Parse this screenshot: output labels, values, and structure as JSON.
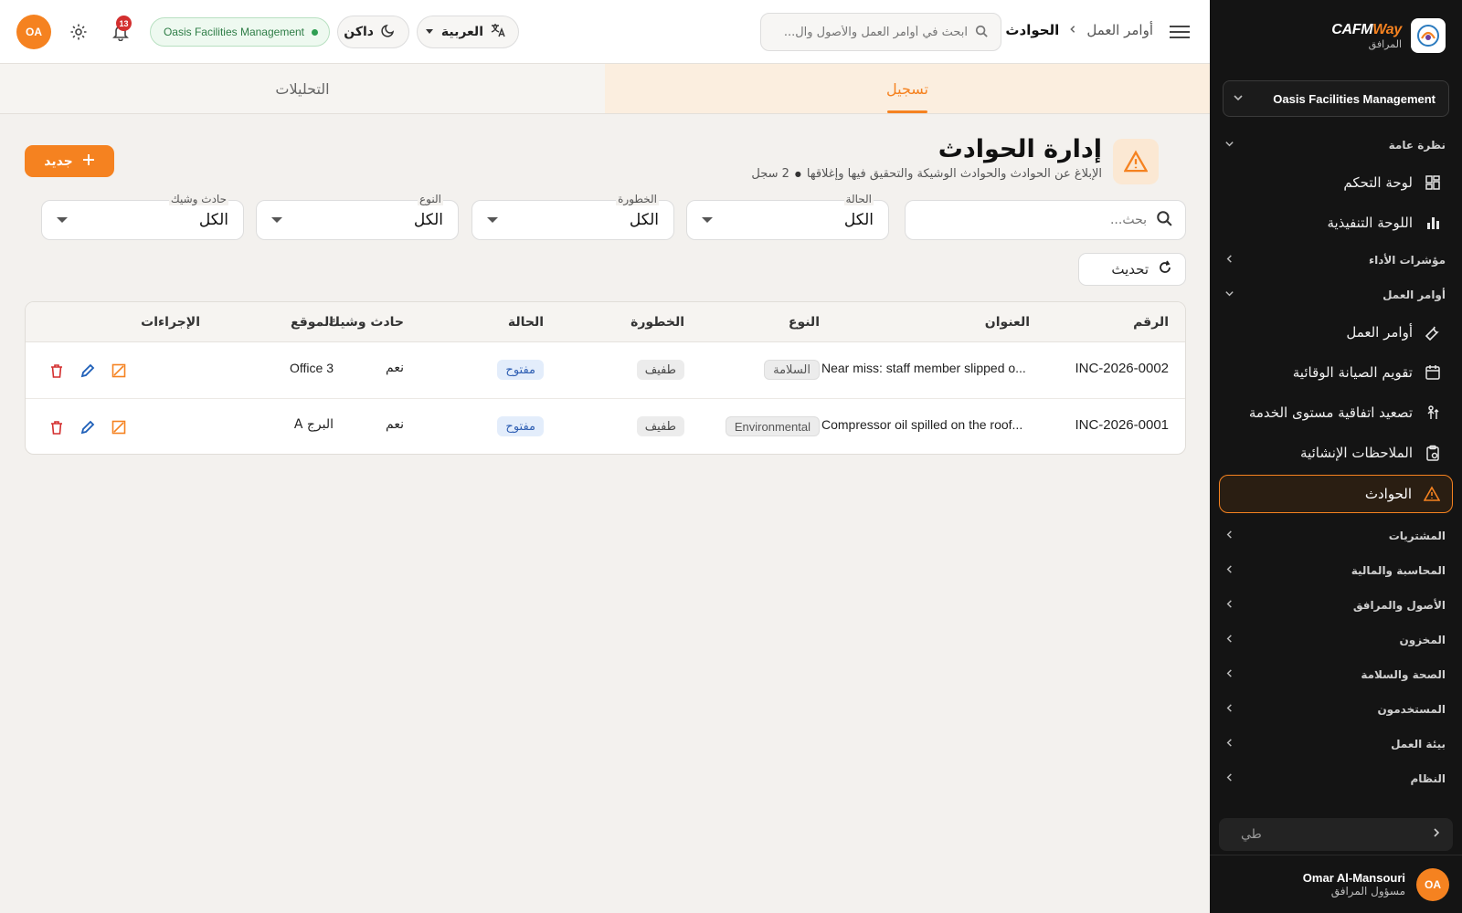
{
  "brand": {
    "name_a": "CAFM",
    "name_b": "Way",
    "subtitle": "المرافق"
  },
  "sidebar": {
    "org_selector": "Oasis Facilities Management",
    "sections": [
      {
        "label": "نظرة عامة",
        "expanded": true,
        "items": [
          {
            "label": "لوحة التحكم",
            "icon": "dashboard-icon"
          },
          {
            "label": "اللوحة التنفيذية",
            "icon": "bar-chart-icon"
          }
        ]
      },
      {
        "label": "مؤشرات الأداء",
        "expanded": false,
        "items": []
      },
      {
        "label": "أوامر العمل",
        "expanded": true,
        "items": [
          {
            "label": "أوامر العمل",
            "icon": "wrench-icon"
          },
          {
            "label": "تقويم الصيانة الوقائية",
            "icon": "calendar-icon"
          },
          {
            "label": "تصعيد اتفاقية مستوى الخدمة",
            "icon": "escalation-icon"
          },
          {
            "label": "الملاحظات الإنشائية",
            "icon": "clipboard-icon"
          },
          {
            "label": "الحوادث",
            "icon": "warning-icon",
            "active": true
          }
        ]
      },
      {
        "label": "المشتريات",
        "expanded": false,
        "items": []
      },
      {
        "label": "المحاسبة والمالية",
        "expanded": false,
        "items": []
      },
      {
        "label": "الأصول والمرافق",
        "expanded": false,
        "items": []
      },
      {
        "label": "المخزون",
        "expanded": false,
        "items": []
      },
      {
        "label": "الصحة والسلامة",
        "expanded": false,
        "items": []
      },
      {
        "label": "المستخدمون",
        "expanded": false,
        "items": []
      },
      {
        "label": "بيئة العمل",
        "expanded": false,
        "items": []
      },
      {
        "label": "النظام",
        "expanded": false,
        "items": []
      }
    ],
    "collapse_label": "طي",
    "user": {
      "initials": "OA",
      "name": "Omar Al-Mansouri",
      "role": "مسؤول المرافق"
    }
  },
  "topbar": {
    "breadcrumb": [
      "أوامر العمل",
      "الحوادث"
    ],
    "search_placeholder": "ابحث في أوامر العمل والأصول وال...",
    "language": "العربية",
    "theme": "داكن",
    "org_badge": "Oasis Facilities Management",
    "notifications_count": "13",
    "avatar_initials": "OA"
  },
  "tabs": [
    {
      "label": "تسجيل",
      "active": true
    },
    {
      "label": "التحليلات",
      "active": false
    }
  ],
  "page": {
    "title": "إدارة الحوادث",
    "subtitle": "الإبلاغ عن الحوادث والحوادث الوشيكة والتحقيق فيها وإغلاقها",
    "count": "2 سجل",
    "new_button": "جديد"
  },
  "filters": {
    "search_placeholder": "بحث...",
    "status": {
      "label": "الحالة",
      "value": "الكل"
    },
    "severity": {
      "label": "الخطورة",
      "value": "الكل"
    },
    "type": {
      "label": "النوع",
      "value": "الكل"
    },
    "near_miss": {
      "label": "حادث وشيك",
      "value": "الكل"
    },
    "refresh": "تحديث"
  },
  "table": {
    "headers": {
      "number": "الرقم",
      "title": "العنوان",
      "type": "النوع",
      "severity": "الخطورة",
      "status": "الحالة",
      "near_miss": "حادث وشيك",
      "location": "الموقع",
      "actions": "الإجراءات"
    },
    "rows": [
      {
        "number": "INC-2026-0002",
        "title": "Near miss: staff member slipped o...",
        "type": "السلامة",
        "severity": "طفيف",
        "status": "مفتوح",
        "near_miss": "نعم",
        "location": "Office 3"
      },
      {
        "number": "INC-2026-0001",
        "title": "Compressor oil spilled on the roof...",
        "type": "Environmental",
        "severity": "طفيف",
        "status": "مفتوح",
        "near_miss": "نعم",
        "location": "البرج A"
      }
    ]
  },
  "colors": {
    "accent": "#f58220",
    "sidebar_bg": "#141414",
    "status_blue": "#2f5fb3",
    "danger": "#d32f2f"
  }
}
